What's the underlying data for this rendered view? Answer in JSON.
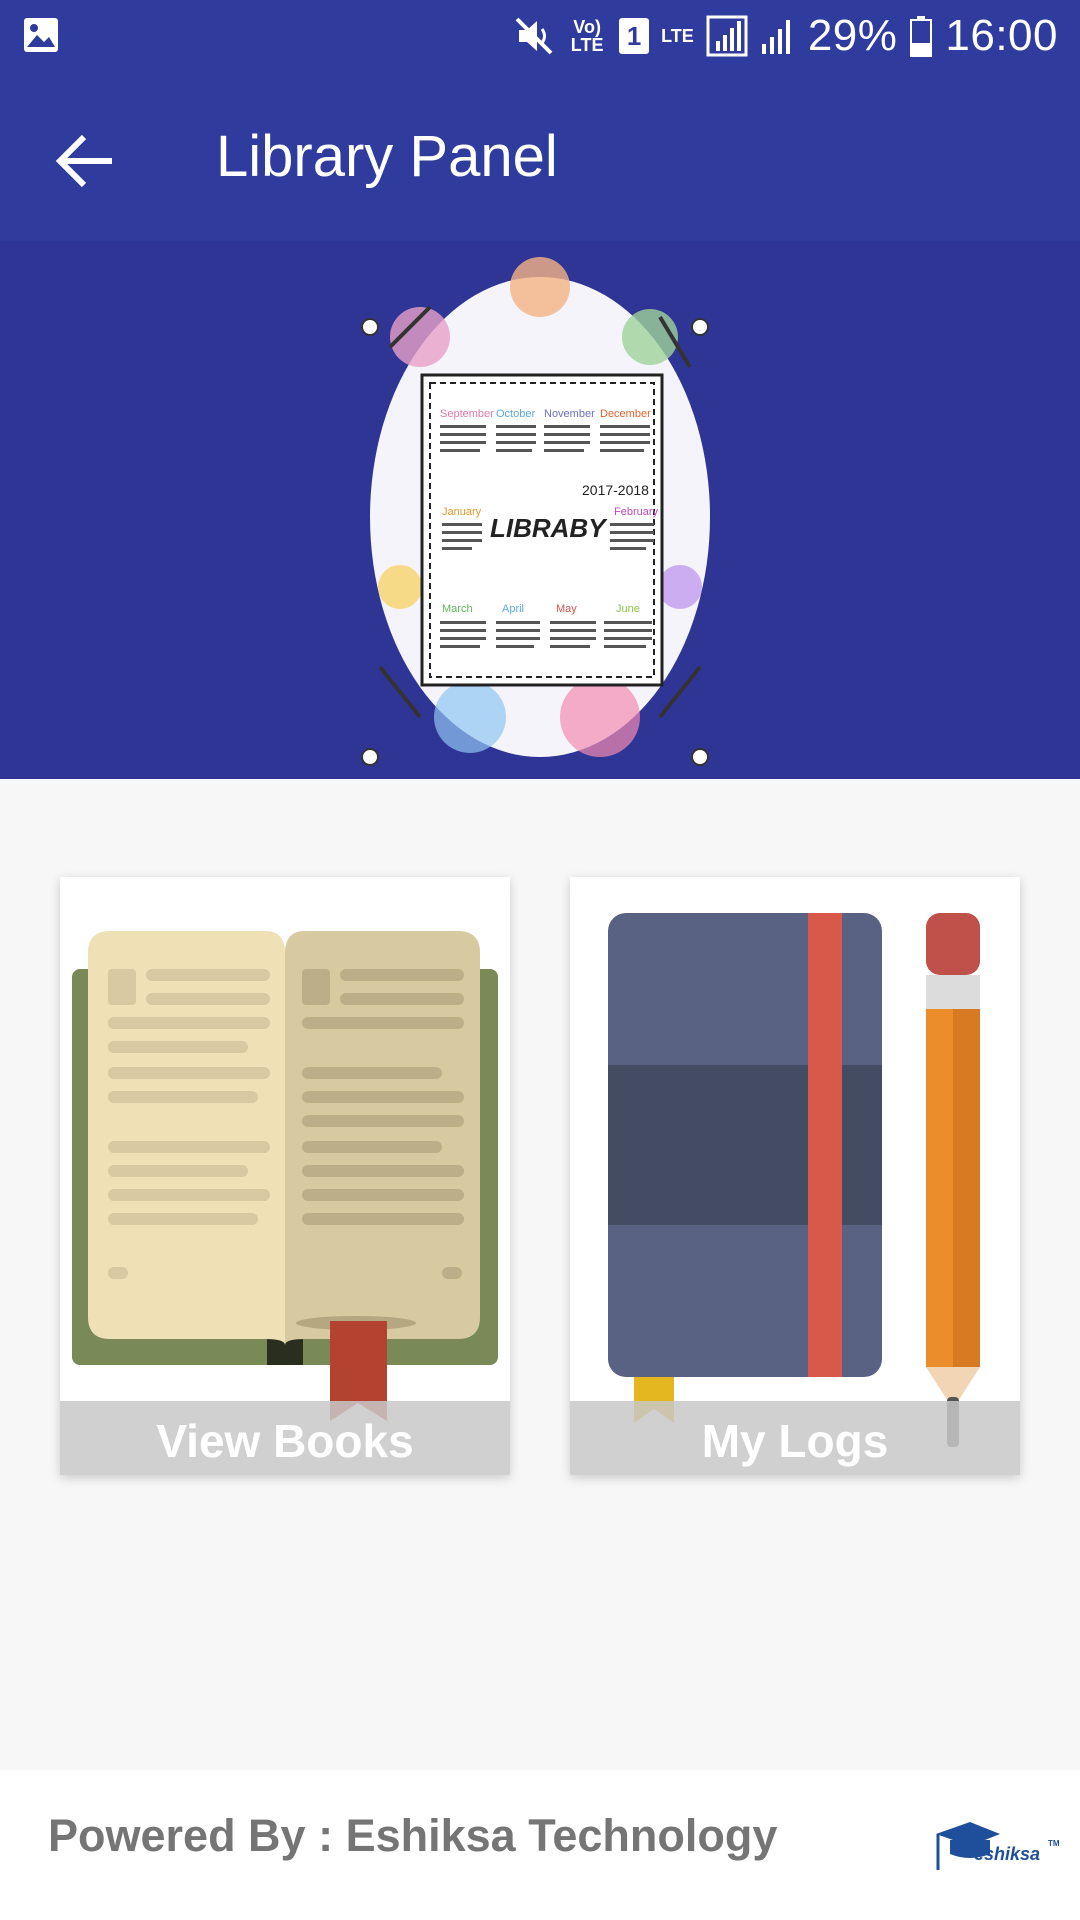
{
  "status_bar": {
    "icons": [
      "gallery-icon",
      "mute-icon",
      "volte-icon",
      "sim-icon",
      "lte-icon",
      "signal-icon",
      "signal-icon-2",
      "battery-icon"
    ],
    "volte_text": "Vo) LTE",
    "sim_number": "1",
    "lte_text": "LTE",
    "battery": "29%",
    "time": "16:00"
  },
  "toolbar": {
    "title": "Library Panel",
    "back_icon": "arrow-left-icon"
  },
  "banner": {
    "months_top": [
      "September",
      "October",
      "November",
      "December"
    ],
    "months_mid": [
      "January",
      "February"
    ],
    "months_bottom": [
      "March",
      "April",
      "May",
      "June"
    ],
    "year": "2017-2018",
    "word": "LIBRABY"
  },
  "cards": [
    {
      "label": "View Books",
      "icon": "open-book-icon"
    },
    {
      "label": "My Logs",
      "icon": "notebook-pencil-icon"
    }
  ],
  "footer": {
    "powered_by": "Powered By : Eshiksa Technology",
    "logo_text": "eshiksa",
    "logo_tm": "TM"
  },
  "colors": {
    "primary": "#2f3b9d",
    "banner": "#2f3595",
    "footer_text": "#757575"
  }
}
